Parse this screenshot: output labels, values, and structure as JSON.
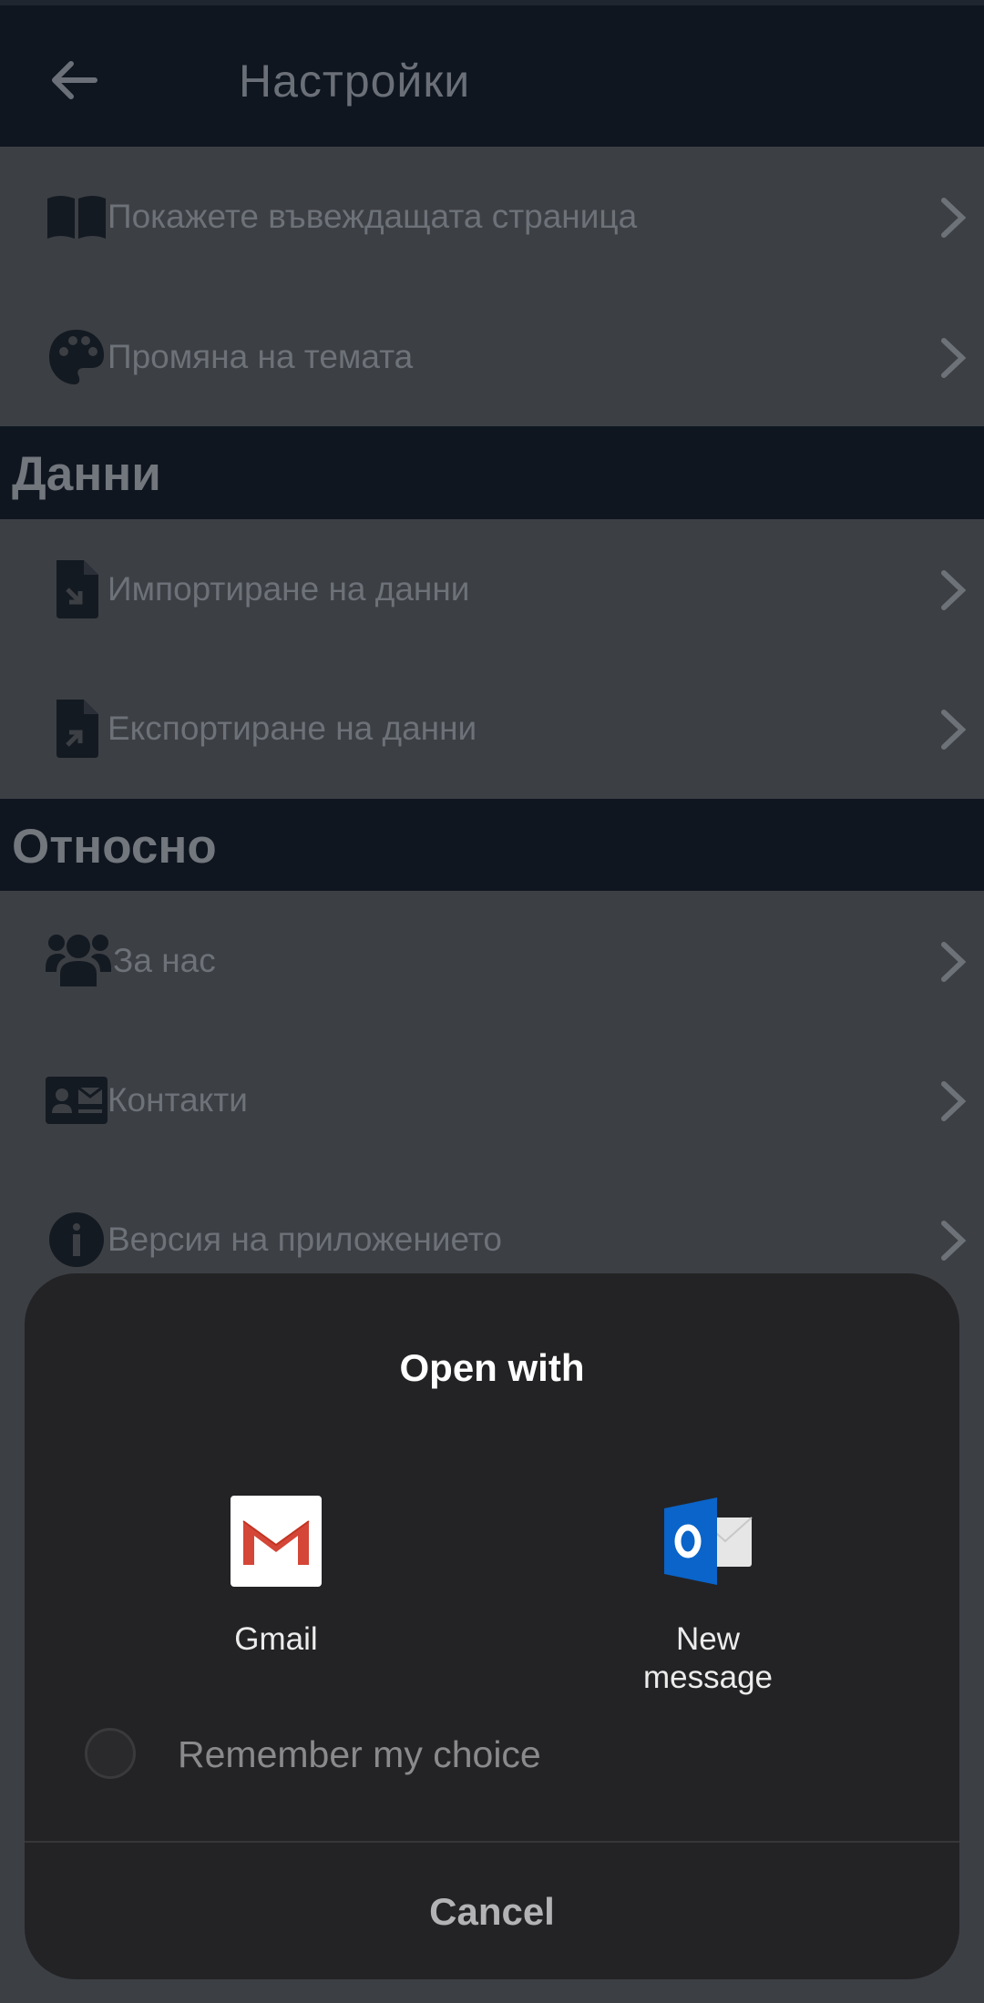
{
  "appbar": {
    "title": "Настройки",
    "back_icon": "arrow-left-icon"
  },
  "general": {
    "items": [
      {
        "label": "Покажете въвеждащата страница",
        "icon": "book-open-icon"
      },
      {
        "label": "Промяна на темата",
        "icon": "palette-icon"
      }
    ]
  },
  "data_section": {
    "title": "Данни",
    "items": [
      {
        "label": "Импортиране на данни",
        "icon": "file-import-icon"
      },
      {
        "label": "Експортиране на данни",
        "icon": "file-export-icon"
      }
    ]
  },
  "about_section": {
    "title": "Относно",
    "items": [
      {
        "label": "За нас",
        "icon": "users-icon"
      },
      {
        "label": "Контакти",
        "icon": "contact-card-icon"
      },
      {
        "label": "Версия на приложението",
        "icon": "info-icon"
      }
    ]
  },
  "dialog": {
    "title": "Open with",
    "apps": [
      {
        "name": "Gmail",
        "icon": "gmail-icon"
      },
      {
        "name": "New message",
        "line1": "New",
        "line2": "message",
        "icon": "outlook-icon"
      }
    ],
    "remember_label": "Remember my choice",
    "remember_checked": false,
    "cancel_label": "Cancel"
  },
  "colors": {
    "appbar_bg": "#0f161f",
    "list_bg": "#3c3f44",
    "sheet_bg": "#232325",
    "gmail_red": "#d44638",
    "outlook_blue": "#0a64c9"
  }
}
